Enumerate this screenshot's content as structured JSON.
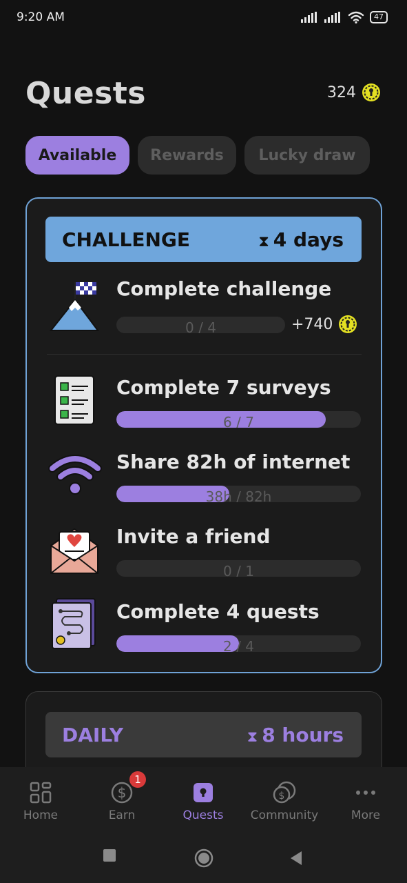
{
  "status": {
    "time": "9:20 AM",
    "battery": "47"
  },
  "header": {
    "title": "Quests",
    "coins": "324"
  },
  "tabs": [
    {
      "label": "Available",
      "active": true
    },
    {
      "label": "Rewards",
      "active": false
    },
    {
      "label": "Lucky draw",
      "active": false
    }
  ],
  "challenge": {
    "label": "CHALLENGE",
    "time_left": "4 days",
    "main": {
      "title": "Complete challenge",
      "progress_label": "0 / 4",
      "progress": 0.0,
      "reward": "+740"
    },
    "quests": [
      {
        "title": "Complete 7 surveys",
        "progress_label": "6 / 7",
        "progress": 0.857,
        "icon": "checklist-icon"
      },
      {
        "title": "Share 82h of internet",
        "progress_label": "38h / 82h",
        "progress": 0.463,
        "icon": "wifi-icon"
      },
      {
        "title": "Invite a friend",
        "progress_label": "0 / 1",
        "progress": 0.0,
        "icon": "envelope-heart-icon"
      },
      {
        "title": "Complete 4 quests",
        "progress_label": "2 / 4",
        "progress": 0.5,
        "icon": "map-book-icon"
      }
    ]
  },
  "daily": {
    "label": "DAILY",
    "time_left": "8 hours"
  },
  "nav": [
    {
      "label": "Home",
      "icon": "home-grid-icon",
      "active": false
    },
    {
      "label": "Earn",
      "icon": "dollar-icon",
      "active": false,
      "badge": "1"
    },
    {
      "label": "Quests",
      "icon": "quests-icon",
      "active": true
    },
    {
      "label": "Community",
      "icon": "community-icon",
      "active": false
    },
    {
      "label": "More",
      "icon": "more-icon",
      "active": false
    }
  ],
  "colors": {
    "accent": "#9c7fe0",
    "challenge_blue": "#6fa6dc",
    "coin": "#e3e022",
    "background": "#121212"
  }
}
